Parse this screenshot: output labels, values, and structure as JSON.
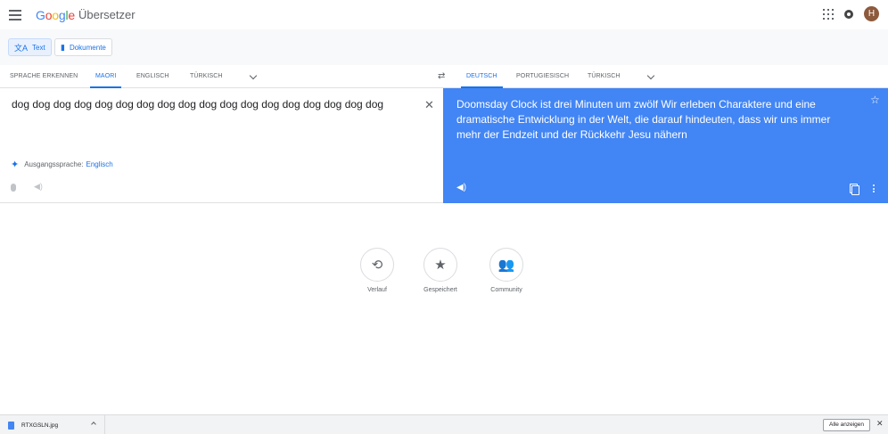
{
  "header": {
    "logo_letters": [
      "G",
      "o",
      "o",
      "g",
      "l",
      "e"
    ],
    "app_name": "Übersetzer",
    "avatar_letter": "H"
  },
  "modes": {
    "text_label": "Text",
    "documents_label": "Dokumente"
  },
  "source_langs": {
    "detect": "SPRACHE ERKENNEN",
    "maori": "MAORI",
    "english": "ENGLISCH",
    "turkish": "TÜRKISCH"
  },
  "target_langs": {
    "german": "DEUTSCH",
    "portuguese": "PORTUGIESISCH",
    "turkish": "TÜRKISCH"
  },
  "source": {
    "text": "dog dog dog dog dog dog dog dog dog dog dog dog dog dog dog dog dog dog",
    "detected_prefix": "Ausgangssprache:",
    "detected_lang": "Englisch"
  },
  "target": {
    "text": "Doomsday Clock ist drei Minuten um zwölf Wir erleben Charaktere und eine dramatische Entwicklung in der Welt, die darauf hindeuten, dass wir uns immer mehr der Endzeit und der Rückkehr Jesu nähern"
  },
  "actions": {
    "history": "Verlauf",
    "saved": "Gespeichert",
    "community": "Community"
  },
  "download_shelf": {
    "file_name": "RTXGSLN.jpg",
    "show_all": "Alle anzeigen"
  },
  "colors": {
    "accent": "#1a73e8",
    "target_panel": "#4285f4",
    "avatar": "#8d5a3c"
  }
}
